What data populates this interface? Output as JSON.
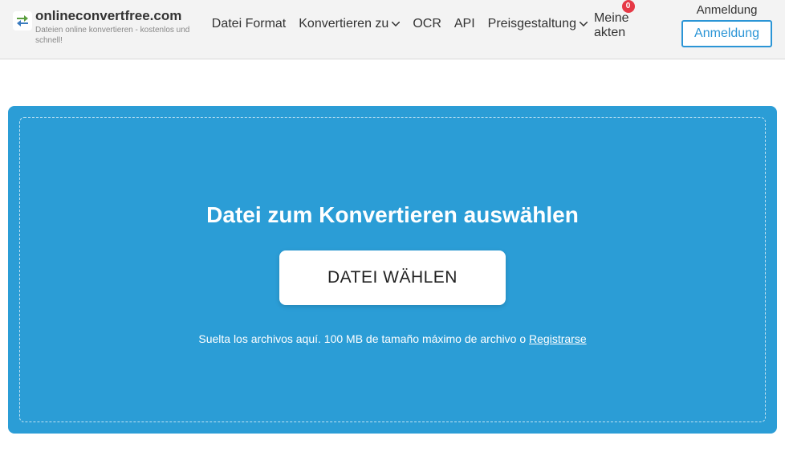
{
  "brand": {
    "name": "onlineconvertfree.com",
    "tagline": "Dateien online konvertieren - kostenlos und schnell!"
  },
  "nav": {
    "file_format": "Datei Format",
    "convert_to": "Konvertieren zu",
    "ocr": "OCR",
    "api": "API",
    "pricing": "Preisgestaltung"
  },
  "header": {
    "my_files": "Meine akten",
    "badge_count": "0",
    "login": "Anmeldung",
    "signup": "Anmeldung"
  },
  "dropzone": {
    "title": "Datei zum Konvertieren auswählen",
    "button": "DATEI WÄHLEN",
    "hint_prefix": "Suelta los archivos aquí. 100 MB de tamaño máximo de archivo o ",
    "register": "Registrarse"
  }
}
